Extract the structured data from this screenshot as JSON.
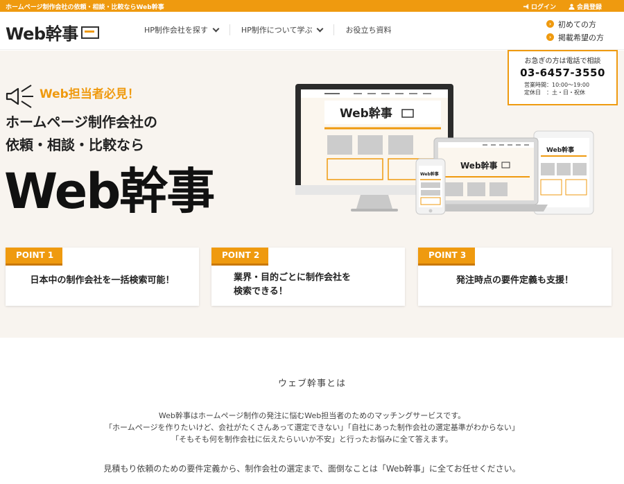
{
  "topbar": {
    "tagline": "ホームページ制作会社の依頼・相談・比較ならWeb幹事",
    "login": "ログイン",
    "register": "会員登録"
  },
  "header": {
    "logo": "Web幹事",
    "nav": [
      {
        "label": "HP制作会社を探す"
      },
      {
        "label": "HP制作について学ぶ"
      },
      {
        "label": "お役立ち資料"
      }
    ],
    "side_links": [
      "初めての方",
      "掲載希望の方"
    ]
  },
  "phone": {
    "label": "お急ぎの方は電話で相談",
    "number": "03-6457-3550",
    "hours": "営業時間：10:00〜19:00",
    "holidays": "定休日　：土・日・祝休"
  },
  "hero": {
    "catch": "Web担当者必見！",
    "lead1": "ホームページ制作会社の",
    "lead2": "依頼・相談・比較なら",
    "brand": "Web幹事",
    "mock_brand": "Web幹事"
  },
  "points": [
    {
      "badge": "POINT 1",
      "text": "日本中の制作会社を一括検索可能！"
    },
    {
      "badge": "POINT 2",
      "line1": "業界・目的ごとに制作会社を",
      "line2": "検索できる！"
    },
    {
      "badge": "POINT 3",
      "text": "発注時点の要件定義も支援！"
    }
  ],
  "about": {
    "title": "ウェブ幹事とは",
    "lines": [
      "Web幹事はホームページ制作の発注に悩むWeb担当者のためのマッチングサービスです。",
      "「ホームページを作りたいけど、会社がたくさんあって選定できない」「自社にあった制作会社の選定基準がわからない」",
      "「そもそも何を制作会社に伝えたらいいか不安」と行ったお悩みに全て答えます。"
    ],
    "footer": "見積もり依頼のための要件定義から、制作会社の選定まで、面倒なことは「Web幹事」に全てお任せください。"
  },
  "colors": {
    "accent": "#ef9a0f",
    "hero_bg": "#f8f4ef"
  }
}
